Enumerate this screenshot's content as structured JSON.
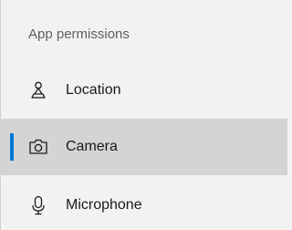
{
  "section": {
    "title": "App permissions"
  },
  "items": [
    {
      "label": "Location",
      "icon": "location-icon",
      "selected": false
    },
    {
      "label": "Camera",
      "icon": "camera-icon",
      "selected": true
    },
    {
      "label": "Microphone",
      "icon": "microphone-icon",
      "selected": false
    }
  ],
  "colors": {
    "accent": "#0078d7",
    "selected_bg": "#d4d4d4",
    "background": "#f2f2f2"
  }
}
